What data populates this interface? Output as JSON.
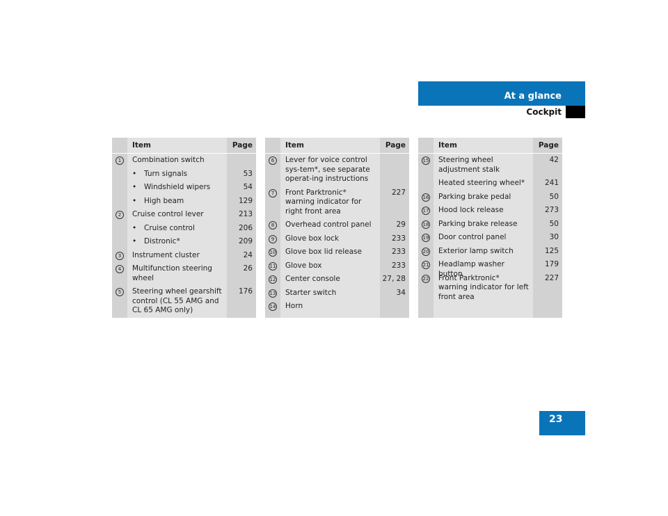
{
  "header": {
    "section": "At a glance",
    "subsection": "Cockpit"
  },
  "page_number": "23",
  "tables": [
    {
      "columns": {
        "item": "Item",
        "page": "Page"
      },
      "rows": [
        {
          "num": "1",
          "item": "Combination switch",
          "page": "",
          "lines": 1
        },
        {
          "num": "",
          "bullet": "•",
          "item": "Turn signals",
          "page": "53",
          "lines": 1
        },
        {
          "num": "",
          "bullet": "•",
          "item": "Windshield wipers",
          "page": "54",
          "lines": 1
        },
        {
          "num": "",
          "bullet": "•",
          "item": "High beam",
          "page": "129",
          "lines": 1
        },
        {
          "num": "2",
          "item": "Cruise control lever",
          "page": "213",
          "lines": 1
        },
        {
          "num": "",
          "bullet": "•",
          "item": "Cruise control",
          "page": "206",
          "lines": 1
        },
        {
          "num": "",
          "bullet": "•",
          "item": "Distronic*",
          "page": "209",
          "lines": 1
        },
        {
          "num": "3",
          "item": "Instrument cluster",
          "page": "24",
          "lines": 1
        },
        {
          "num": "4",
          "item": "Multifunction steering wheel",
          "page": "26",
          "lines": 2
        },
        {
          "num": "5",
          "item": "Steering wheel gearshift control (CL 55 AMG and CL 65 AMG only)",
          "page": "176",
          "lines": 3
        }
      ]
    },
    {
      "columns": {
        "item": "Item",
        "page": "Page"
      },
      "rows": [
        {
          "num": "6",
          "item": "Lever for voice control sys-tem*, see separate operat-ing instructions",
          "page": "",
          "lines": 3
        },
        {
          "num": "7",
          "item": "Front Parktronic* warning indicator for right front area",
          "page": "227",
          "lines": 3
        },
        {
          "num": "8",
          "item": "Overhead control panel",
          "page": "29",
          "lines": 1
        },
        {
          "num": "9",
          "item": "Glove box lock",
          "page": "233",
          "lines": 1
        },
        {
          "num": "10",
          "item": "Glove box lid release",
          "page": "233",
          "lines": 1
        },
        {
          "num": "11",
          "item": "Glove box",
          "page": "233",
          "lines": 1
        },
        {
          "num": "12",
          "item": "Center console",
          "page": "27, 28",
          "lines": 1
        },
        {
          "num": "13",
          "item": "Starter switch",
          "page": "34",
          "lines": 1
        },
        {
          "num": "14",
          "item": "Horn",
          "page": "",
          "lines": 1
        }
      ]
    },
    {
      "columns": {
        "item": "Item",
        "page": "Page"
      },
      "rows": [
        {
          "num": "15",
          "item": "Steering wheel adjustment stalk",
          "page": "42",
          "lines": 2
        },
        {
          "num": "",
          "item": "Heated steering wheel*",
          "page": "241",
          "lines": 1
        },
        {
          "num": "16",
          "item": "Parking brake pedal",
          "page": "50",
          "lines": 1
        },
        {
          "num": "17",
          "item": "Hood lock release",
          "page": "273",
          "lines": 1
        },
        {
          "num": "18",
          "item": "Parking brake release",
          "page": "50",
          "lines": 1
        },
        {
          "num": "19",
          "item": "Door control panel",
          "page": "30",
          "lines": 1
        },
        {
          "num": "20",
          "item": "Exterior lamp switch",
          "page": "125",
          "lines": 1
        },
        {
          "num": "21",
          "item": "Headlamp washer button",
          "page": "179",
          "lines": 1
        },
        {
          "num": "22",
          "item": "Front Parktronic* warning indicator for left front area",
          "page": "227",
          "lines": 2
        }
      ]
    }
  ]
}
